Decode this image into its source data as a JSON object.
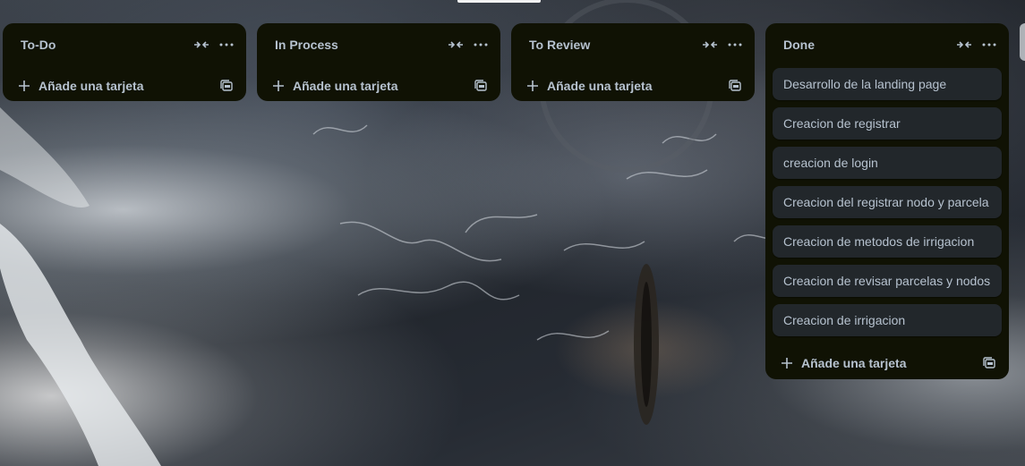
{
  "board": {
    "lists": [
      {
        "title": "To-Do",
        "cards": [],
        "add_label": "Añade una tarjeta"
      },
      {
        "title": "In Process",
        "cards": [],
        "add_label": "Añade una tarjeta"
      },
      {
        "title": "To Review",
        "cards": [],
        "add_label": "Añade una tarjeta"
      },
      {
        "title": "Done",
        "cards": [
          "Desarrollo de la landing page",
          "Creacion de registrar",
          "creacion de login",
          "Creacion del registrar nodo y parcela",
          "Creacion de metodos de irrigacion",
          "Creacion de revisar parcelas y nodos",
          "Creacion de irrigacion"
        ],
        "add_label": "Añade una tarjeta"
      }
    ]
  },
  "icons": {
    "collapse": "collapse-arrows-icon",
    "menu": "more-horizontal-icon",
    "add": "plus-icon",
    "template": "card-template-icon"
  },
  "colors": {
    "list_bg": "#101204",
    "card_bg": "#22272b",
    "text": "#b6c2cf"
  }
}
